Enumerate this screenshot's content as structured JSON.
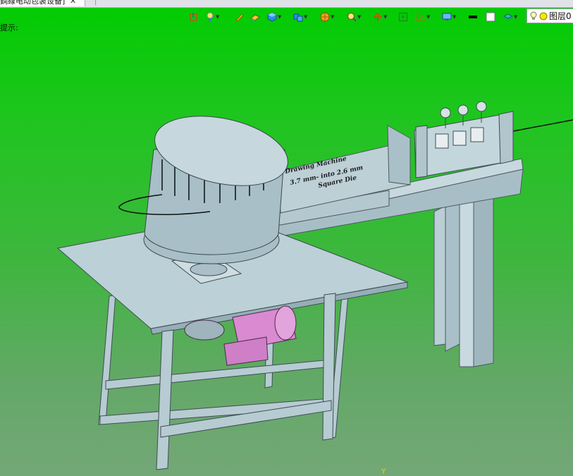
{
  "tab": {
    "title": "鋼線电动包装设备]",
    "close": "✕",
    "separator": "|"
  },
  "status": {
    "hint": "提示:"
  },
  "toolbar": {
    "tools": [
      {
        "name": "sketch-tool-icon",
        "dropdown": false
      },
      {
        "name": "light-bulb-pin-icon",
        "dropdown": true
      },
      {
        "name": "pen-icon",
        "dropdown": false
      },
      {
        "name": "eraser-icon",
        "dropdown": false
      },
      {
        "name": "cube-icon",
        "dropdown": true
      },
      {
        "name": "multi-cube-icon",
        "dropdown": true
      },
      {
        "name": "render-sphere-icon",
        "dropdown": true
      },
      {
        "name": "zoom-search-icon",
        "dropdown": true
      },
      {
        "name": "rotate-axis-icon",
        "dropdown": true
      },
      {
        "name": "fit-view-icon",
        "dropdown": false
      },
      {
        "name": "section-plane-icon",
        "dropdown": true
      },
      {
        "name": "display-monitor-icon",
        "dropdown": true
      },
      {
        "name": "black-swatch-icon",
        "dropdown": false
      },
      {
        "name": "white-swatch-icon",
        "dropdown": false
      },
      {
        "name": "layers-stack-icon",
        "dropdown": true
      }
    ]
  },
  "layer": {
    "label": "图层0"
  },
  "model": {
    "engraving": [
      "Drawing Machine",
      "3.7 mm- into 2.6 mm",
      "Square Die"
    ]
  },
  "axis": {
    "y_label": "Y"
  },
  "colors": {
    "viewport_top": "#00cc00",
    "viewport_bottom": "#73a777",
    "part_steel": "#b8cdd5",
    "motor": "#d98ad1"
  }
}
